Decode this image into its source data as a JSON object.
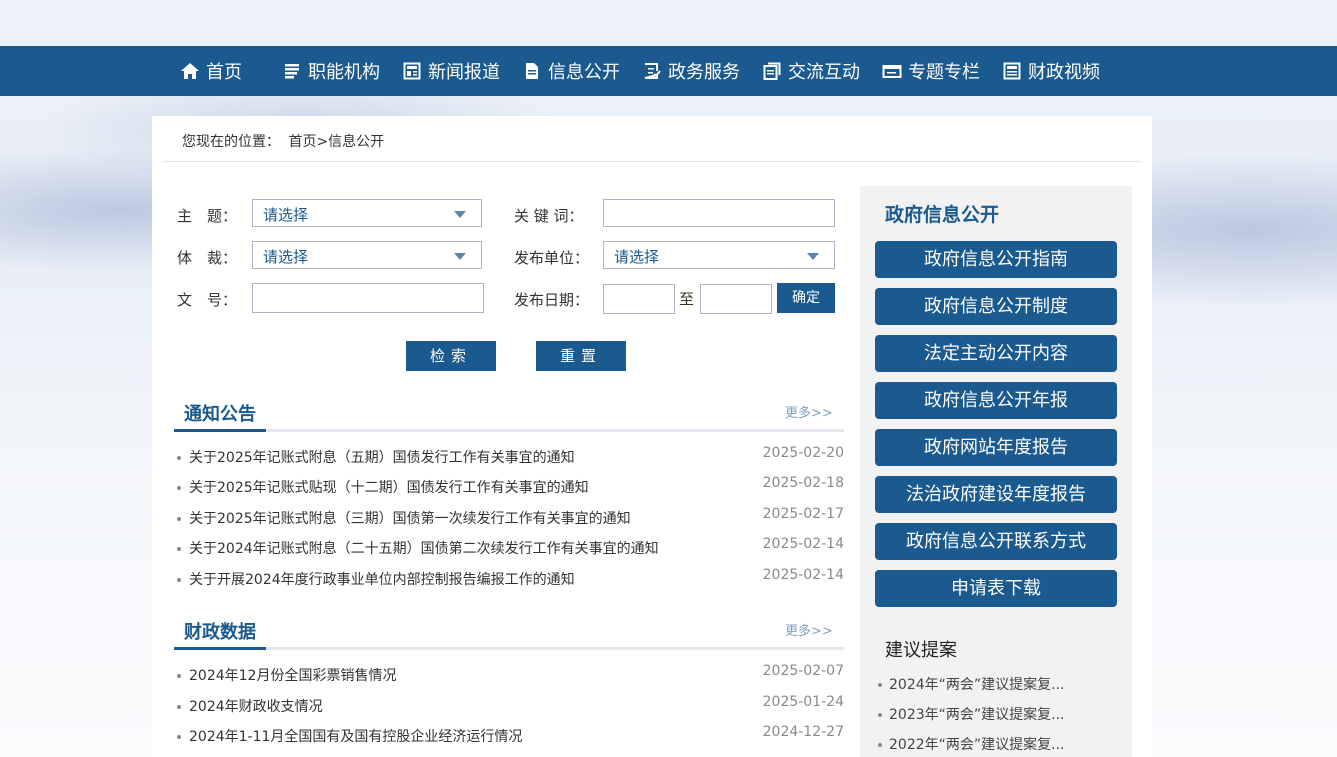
{
  "nav": [
    {
      "label": "首页",
      "icon": "home-icon"
    },
    {
      "label": "职能机构",
      "icon": "list-icon"
    },
    {
      "label": "新闻报道",
      "icon": "news-icon"
    },
    {
      "label": "信息公开",
      "icon": "document-icon"
    },
    {
      "label": "政务服务",
      "icon": "service-icon"
    },
    {
      "label": "交流互动",
      "icon": "chat-icon"
    },
    {
      "label": "专题专栏",
      "icon": "folder-icon"
    },
    {
      "label": "财政视频",
      "icon": "video-icon"
    }
  ],
  "breadcrumb": {
    "prefix": "您现在的位置：",
    "path": "首页>信息公开"
  },
  "form": {
    "topic_label": "主　题：",
    "topic_value": "请选择",
    "keyword_label": "关 键 词：",
    "genre_label": "体　裁：",
    "genre_value": "请选择",
    "publisher_label": "发布单位：",
    "publisher_value": "请选择",
    "docno_label": "文　号：",
    "date_label": "发布日期：",
    "date_to": "至",
    "confirm": "确定",
    "search": "检索",
    "reset": "重置"
  },
  "notices": {
    "title": "通知公告",
    "more": "更多>>",
    "items": [
      {
        "title": "关于2025年记账式附息（五期）国债发行工作有关事宜的通知",
        "date": "2025-02-20"
      },
      {
        "title": "关于2025年记账式贴现（十二期）国债发行工作有关事宜的通知",
        "date": "2025-02-18"
      },
      {
        "title": "关于2025年记账式附息（三期）国债第一次续发行工作有关事宜的通知",
        "date": "2025-02-17"
      },
      {
        "title": "关于2024年记账式附息（二十五期）国债第二次续发行工作有关事宜的通知",
        "date": "2025-02-14"
      },
      {
        "title": "关于开展2024年度行政事业单位内部控制报告编报工作的通知",
        "date": "2025-02-14"
      }
    ]
  },
  "finance": {
    "title": "财政数据",
    "more": "更多>>",
    "items": [
      {
        "title": "2024年12月份全国彩票销售情况",
        "date": "2025-02-07"
      },
      {
        "title": "2024年财政收支情况",
        "date": "2025-01-24"
      },
      {
        "title": "2024年1-11月全国国有及国有控股企业经济运行情况",
        "date": "2024-12-27"
      }
    ]
  },
  "sidebar": {
    "title": "政府信息公开",
    "buttons": [
      "政府信息公开指南",
      "政府信息公开制度",
      "法定主动公开内容",
      "政府信息公开年报",
      "政府网站年度报告",
      "法治政府建设年度报告",
      "政府信息公开联系方式",
      "申请表下载"
    ],
    "sub_title": "建议提案",
    "sub_items": [
      "2024年“两会”建议提案复...",
      "2023年“两会”建议提案复...",
      "2022年“两会”建议提案复..."
    ]
  }
}
